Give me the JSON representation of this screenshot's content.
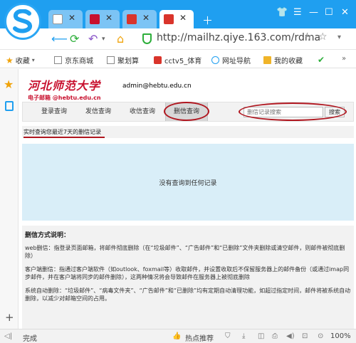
{
  "browser": {
    "tabs": [
      {
        "favicon": "page-icon"
      },
      {
        "favicon": "hebtu-icon"
      },
      {
        "favicon": "netease-mail-icon"
      },
      {
        "favicon": "netease-mail-icon"
      }
    ],
    "url": "http://mailhz.qiye.163.com/rdma",
    "bookmarks": [
      "收藏",
      "京东商城",
      "聚划算",
      "cctv5_体育",
      "网址导航",
      "我的收藏"
    ],
    "status": {
      "left": "完成",
      "recommend": "热点推荐",
      "zoom": "100%"
    }
  },
  "header": {
    "brand_title": "河北师范大学",
    "brand_sub": "电子邮箱 @hebtu.edu.cn",
    "account": "admin@hebtu.edu.cn"
  },
  "query_tabs": [
    {
      "label": "登录查询"
    },
    {
      "label": "发信查询"
    },
    {
      "label": "收信查询"
    },
    {
      "label": "删信查询"
    }
  ],
  "search": {
    "placeholder": "删信记录搜索",
    "button": "搜索"
  },
  "hint": "实时查询您最近7天的删信记录",
  "results": {
    "empty_text": "没有查询到任何记录"
  },
  "help": {
    "title": "删信方式说明：",
    "paragraphs": [
      "web删信：指登录页面邮箱，将邮件彻底删除（在“垃圾邮件”、“广告邮件”和“已删除”文件夹删除或清空邮件，则邮件被彻底删除）",
      "客户端删信：指通过客户端软件（如outlook、foxmail等）收取邮件，并设置收取后不保留服务器上的邮件备份（或通过imap同步邮件，并在客户端将同步的邮件删除），这两种情况将会导致邮件在服务器上被彻底删除",
      "系统自动删除：“垃圾邮件”、“病毒文件夹”、“广告邮件”和“已删除”均有定期自动清理功能，如超过指定时间，邮件将被系统自动删除，以减少对邮箱空间的占用。"
    ]
  },
  "colors": {
    "accent": "#1f9ff0",
    "brand_red": "#c8102e",
    "annotation_red": "#b0161f",
    "results_bg": "#d9eef8"
  }
}
